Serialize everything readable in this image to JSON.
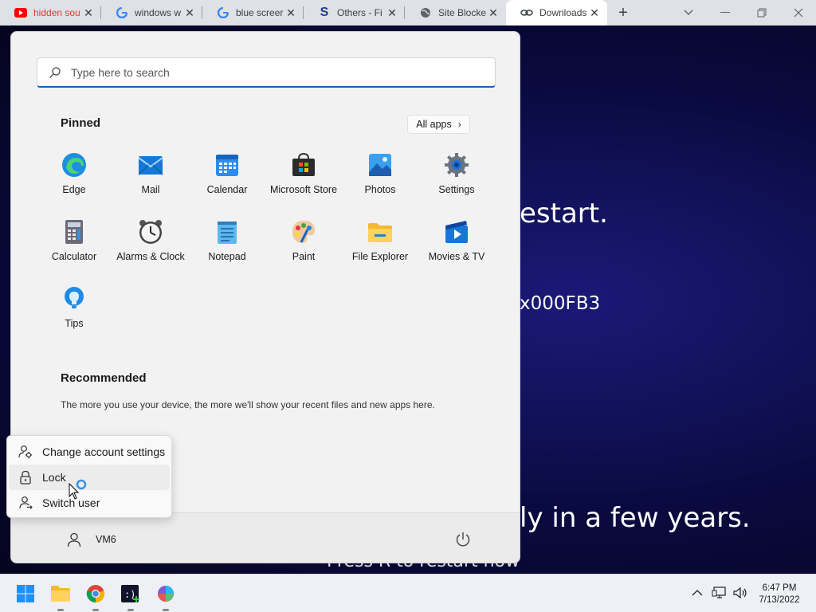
{
  "browser": {
    "tabs": [
      {
        "title": "hidden sou",
        "favicon": "youtube-icon",
        "active": false
      },
      {
        "title": "windows w",
        "favicon": "google-icon",
        "active": false
      },
      {
        "title": "blue screer",
        "favicon": "google-icon",
        "active": false
      },
      {
        "title": "Others - Fi",
        "favicon": "s-logo-icon",
        "active": false
      },
      {
        "title": "Site Blocke",
        "favicon": "globe-icon",
        "active": false
      },
      {
        "title": "Downloads",
        "favicon": "gear-link-icon",
        "active": true
      }
    ],
    "new_tab": "+"
  },
  "bsod": {
    "line1": "estart.",
    "line2": "x000FB3",
    "line3": "ly in a few years.",
    "line4": "Press R to restart now"
  },
  "start_menu": {
    "search_placeholder": "Type here to search",
    "pinned_title": "Pinned",
    "all_apps_label": "All apps",
    "apps": [
      {
        "label": "Edge",
        "icon": "edge-icon"
      },
      {
        "label": "Mail",
        "icon": "mail-icon"
      },
      {
        "label": "Calendar",
        "icon": "calendar-icon"
      },
      {
        "label": "Microsoft Store",
        "icon": "store-icon"
      },
      {
        "label": "Photos",
        "icon": "photos-icon"
      },
      {
        "label": "Settings",
        "icon": "settings-icon"
      },
      {
        "label": "Calculator",
        "icon": "calculator-icon"
      },
      {
        "label": "Alarms & Clock",
        "icon": "clock-icon"
      },
      {
        "label": "Notepad",
        "icon": "notepad-icon"
      },
      {
        "label": "Paint",
        "icon": "paint-icon"
      },
      {
        "label": "File Explorer",
        "icon": "folder-icon"
      },
      {
        "label": "Movies & TV",
        "icon": "movies-icon"
      },
      {
        "label": "Tips",
        "icon": "tips-icon"
      }
    ],
    "recommended_title": "Recommended",
    "recommended_text": "The more you use your device, the more we'll show your recent files and new apps here.",
    "user_name": "VM6"
  },
  "account_menu": {
    "items": [
      {
        "label": "Change account settings",
        "icon": "account-settings-icon"
      },
      {
        "label": "Lock",
        "icon": "lock-icon"
      },
      {
        "label": "Switch user",
        "icon": "switch-user-icon"
      }
    ]
  },
  "taskbar": {
    "time": "6:47 PM",
    "date": "7/13/2022"
  },
  "colors": {
    "accent": "#1a5fb4",
    "start_bg": "#f2f2f2",
    "bsod_bg": "#0a0a40"
  }
}
